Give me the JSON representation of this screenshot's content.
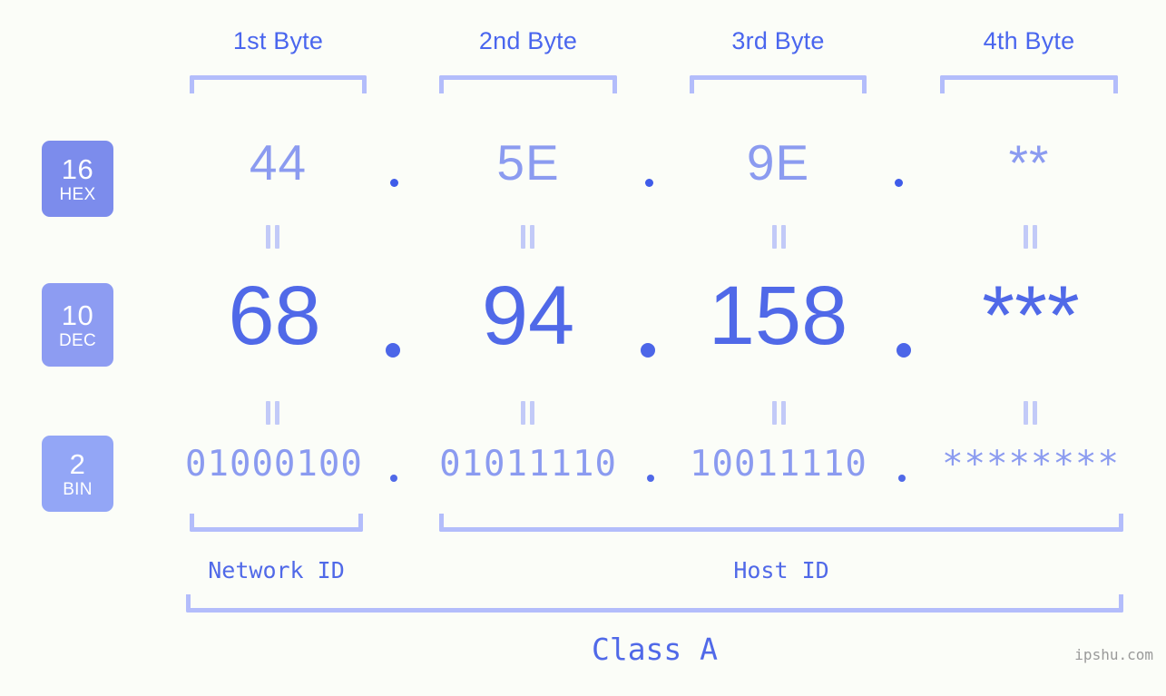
{
  "meta": {
    "watermark": "ipshu.com",
    "accent_strong": "#5069e8",
    "accent_light": "#8b9bf0",
    "bracket_color": "#b3bdfb",
    "background": "#fbfdf8"
  },
  "byte_headers": [
    {
      "label": "1st Byte"
    },
    {
      "label": "2nd Byte"
    },
    {
      "label": "3rd Byte"
    },
    {
      "label": "4th Byte"
    }
  ],
  "rows": [
    {
      "badge_number": "16",
      "badge_abbr": "HEX",
      "badge_color": "#7c8cec",
      "values": [
        "44",
        "5E",
        "9E",
        "**"
      ],
      "separator": "."
    },
    {
      "badge_number": "10",
      "badge_abbr": "DEC",
      "badge_color": "#8d9cf2",
      "values": [
        "68",
        "94",
        "158",
        "***"
      ],
      "separator": "."
    },
    {
      "badge_number": "2",
      "badge_abbr": "BIN",
      "badge_color": "#93a6f6",
      "values": [
        "01000100",
        "01011110",
        "10011110",
        "********"
      ],
      "separator": "."
    }
  ],
  "equals_marker": "=",
  "sections": [
    {
      "label": "Network ID"
    },
    {
      "label": "Host ID"
    }
  ],
  "class": {
    "label": "Class A"
  }
}
